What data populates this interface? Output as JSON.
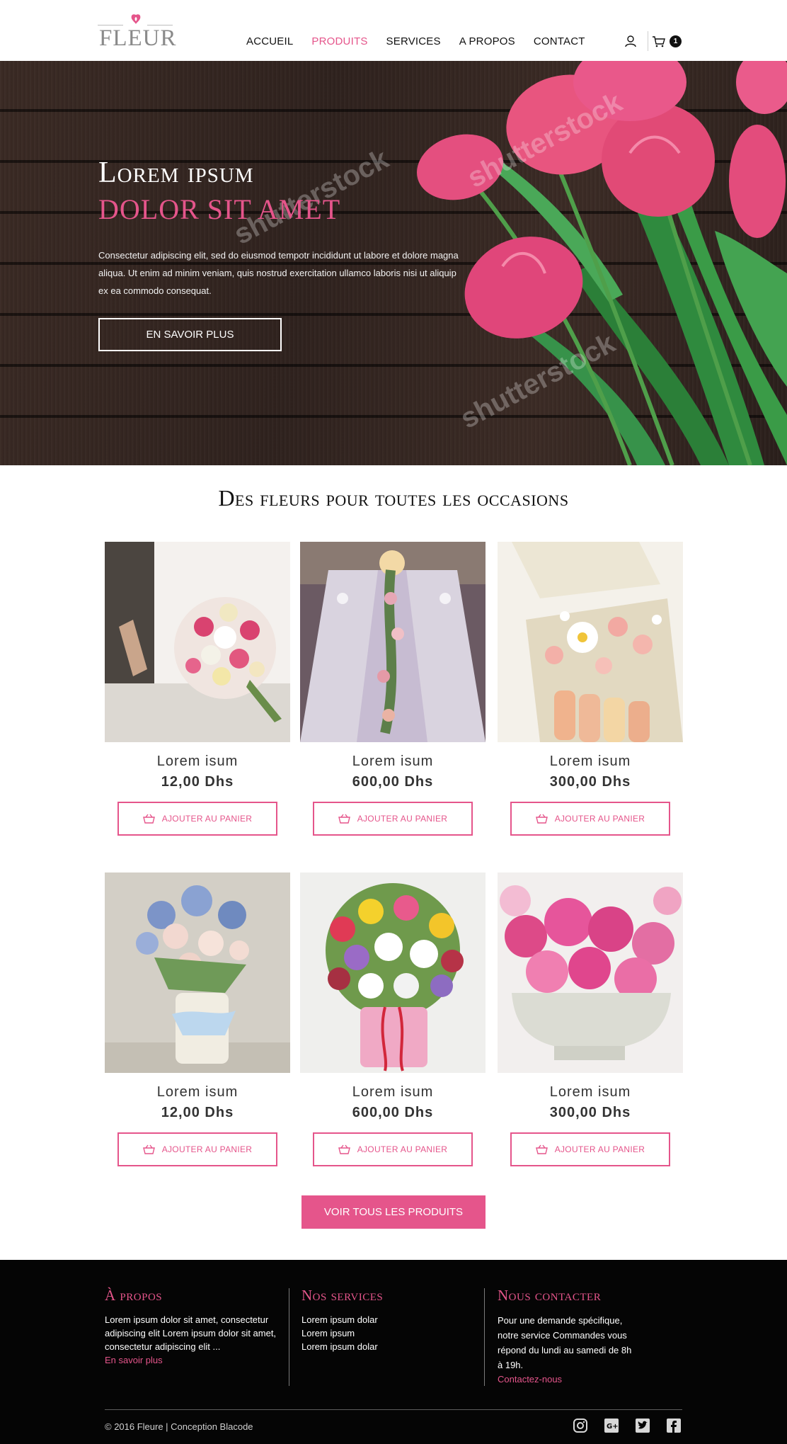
{
  "header": {
    "logo_text": "FLEUR",
    "nav": [
      {
        "label": "ACCUEIL",
        "active": false
      },
      {
        "label": "PRODUITS",
        "active": true
      },
      {
        "label": "SERVICES",
        "active": false
      },
      {
        "label": "A PROPOS",
        "active": false
      },
      {
        "label": "CONTACT",
        "active": false
      }
    ],
    "cart_count": "1"
  },
  "hero": {
    "title_line1": "Lorem ipsum",
    "title_line2": "DOLOR SIT AMET",
    "text": "Consectetur adipiscing elit, sed do eiusmod tempotr incididunt ut labore et dolore magna aliqua. Ut enim ad minim veniam, quis nostrud exercitation ullamco laboris nisi ut aliquip ex ea commodo consequat.",
    "button": "EN SAVOIR PLUS",
    "watermark": "shutterstock"
  },
  "products_section": {
    "title": "Des fleurs pour toutes les occasions",
    "items": [
      {
        "name": "Lorem isum",
        "price": "12,00 Dhs",
        "button": "AJOUTER AU PANIER",
        "image": "bridal-bouquet"
      },
      {
        "name": "Lorem isum",
        "price": "600,00 Dhs",
        "button": "AJOUTER AU PANIER",
        "image": "table-decoration"
      },
      {
        "name": "Lorem isum",
        "price": "300,00 Dhs",
        "button": "AJOUTER AU PANIER",
        "image": "flower-box-macarons"
      },
      {
        "name": "Lorem isum",
        "price": "12,00 Dhs",
        "button": "AJOUTER AU PANIER",
        "image": "vase-bouquet"
      },
      {
        "name": "Lorem isum",
        "price": "600,00 Dhs",
        "button": "AJOUTER AU PANIER",
        "image": "basket-arrangement"
      },
      {
        "name": "Lorem isum",
        "price": "300,00 Dhs",
        "button": "AJOUTER AU PANIER",
        "image": "pink-pot-arrangement"
      }
    ],
    "all_button": "VOIR TOUS LES PRODUITS"
  },
  "footer": {
    "about": {
      "title": "À propos",
      "text": "Lorem ipsum dolor sit amet, consectetur adipiscing elit Lorem ipsum dolor sit amet, consectetur adipiscing elit ...",
      "link": "En savoir plus"
    },
    "services": {
      "title": "Nos services",
      "items": [
        "Lorem ipsum dolar",
        "Lorem ipsum",
        "Lorem ipsum dolar"
      ]
    },
    "contact": {
      "title": "Nous contacter",
      "text": "Pour une demande spécifique, notre service Commandes vous répond du lundi au samedi de 8h à 19h.",
      "link": "Contactez-nous"
    },
    "copyright": "© 2016 Fleure | Conception Blacode",
    "social": [
      "instagram-icon",
      "google-plus-icon",
      "twitter-icon",
      "facebook-icon"
    ]
  },
  "colors": {
    "accent": "#e5558b",
    "footer_bg": "#050505",
    "hero_wood": "#3a2a24"
  }
}
